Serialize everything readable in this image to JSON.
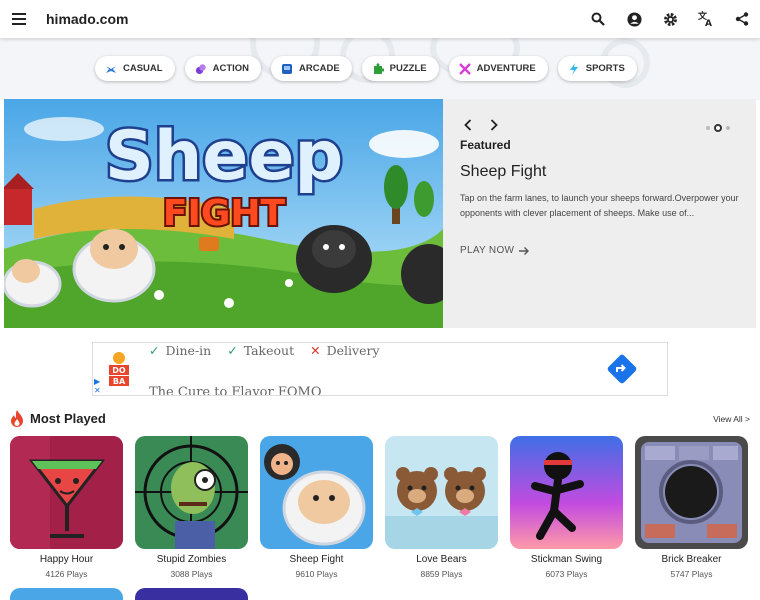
{
  "header": {
    "site_title": "himado.com",
    "icons": [
      "menu-icon",
      "search-icon",
      "account-icon",
      "settings-icon",
      "translate-icon",
      "share-icon"
    ]
  },
  "categories": [
    {
      "label": "CASUAL",
      "icon": "casual-icon",
      "color": "#2f7de1"
    },
    {
      "label": "ACTION",
      "icon": "action-icon",
      "color": "#7a3fd6"
    },
    {
      "label": "ARCADE",
      "icon": "arcade-icon",
      "color": "#1f5fbf"
    },
    {
      "label": "PUZZLE",
      "icon": "puzzle-icon",
      "color": "#2e9d3a"
    },
    {
      "label": "ADVENTURE",
      "icon": "adventure-icon",
      "color": "#d63fd6"
    },
    {
      "label": "SPORTS",
      "icon": "sports-icon",
      "color": "#35b9e6"
    }
  ],
  "featured": {
    "label": "Featured",
    "title": "Sheep Fight",
    "description": "Tap on the farm lanes, to launch your sheeps forward.Overpower your opponents with clever placement of sheeps. Make use of...",
    "cta": "PLAY NOW",
    "image_text_top": "Sheep",
    "image_text_bottom": "FIGHT",
    "slide_count": 3,
    "active_slide": 2
  },
  "ad": {
    "brand": "ODOBA",
    "options": [
      "Dine-in",
      "Takeout",
      "Delivery"
    ],
    "option_states": [
      "check",
      "check",
      "cross"
    ],
    "tagline": "The Cure to Flavor FOMO"
  },
  "most_played": {
    "title": "Most Played",
    "view_all": "View All >",
    "games": [
      {
        "name": "Happy Hour",
        "plays": "4126 Plays"
      },
      {
        "name": "Stupid Zombies",
        "plays": "3088 Plays"
      },
      {
        "name": "Sheep Fight",
        "plays": "9610 Plays"
      },
      {
        "name": "Love Bears",
        "plays": "8859 Plays"
      },
      {
        "name": "Stickman Swing",
        "plays": "6073 Plays"
      },
      {
        "name": "Brick Breaker",
        "plays": "5747 Plays"
      }
    ]
  },
  "colors": {
    "accent": "#1a73e8",
    "flame": "#e8452c"
  }
}
